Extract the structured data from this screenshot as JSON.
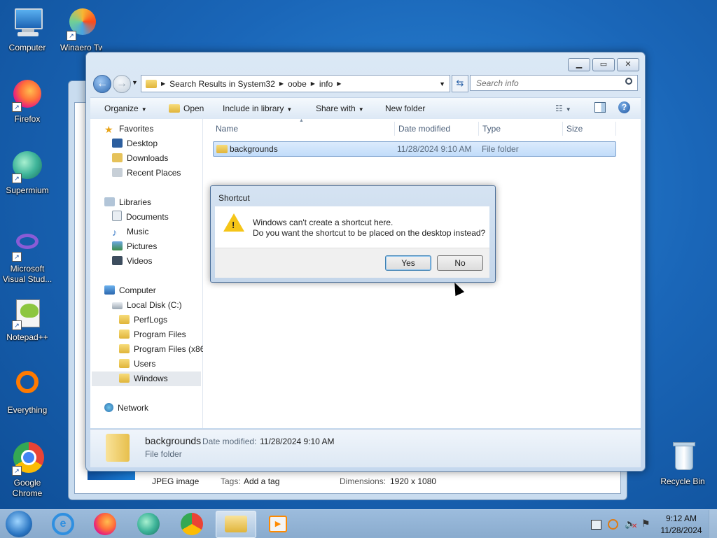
{
  "desktop": {
    "icons": [
      {
        "label": "Computer"
      },
      {
        "label": "Winaero Twea"
      },
      {
        "label": "Firefox"
      },
      {
        "label": "Supermium"
      },
      {
        "label": "Microsoft Visual Stud..."
      },
      {
        "label": "Notepad++"
      },
      {
        "label": "Everything"
      },
      {
        "label": "Google Chrome"
      },
      {
        "label": "Recycle Bin"
      }
    ]
  },
  "back_window": {
    "type_label": "JPEG image",
    "tags_label": "Tags:",
    "tags_value": "Add a tag",
    "dimensions_label": "Dimensions:",
    "dimensions_value": "1920 x 1080"
  },
  "explorer": {
    "address": {
      "segments": [
        "Search Results in System32",
        "oobe",
        "info"
      ]
    },
    "search_placeholder": "Search info",
    "toolbar": {
      "organize": "Organize",
      "open": "Open",
      "include_in_library": "Include in library",
      "share_with": "Share with",
      "new_folder": "New folder"
    },
    "nav": {
      "favorites": "Favorites",
      "desktop": "Desktop",
      "downloads": "Downloads",
      "recent_places": "Recent Places",
      "libraries": "Libraries",
      "documents": "Documents",
      "music": "Music",
      "pictures": "Pictures",
      "videos": "Videos",
      "computer": "Computer",
      "local_disk": "Local Disk (C:)",
      "perflogs": "PerfLogs",
      "program_files": "Program Files",
      "program_files_x86": "Program Files (x86",
      "users": "Users",
      "windows": "Windows",
      "network": "Network"
    },
    "columns": {
      "name": "Name",
      "date_modified": "Date modified",
      "type": "Type",
      "size": "Size"
    },
    "rows": [
      {
        "name": "backgrounds",
        "date": "11/28/2024 9:10 AM",
        "type": "File folder",
        "size": ""
      }
    ],
    "details": {
      "name": "backgrounds",
      "date_label": "Date modified:",
      "date_value": "11/28/2024 9:10 AM",
      "type": "File folder"
    }
  },
  "dialog": {
    "title": "Shortcut",
    "line1": "Windows can't create a shortcut here.",
    "line2": "Do you want the shortcut to be placed on the desktop instead?",
    "yes": "Yes",
    "no": "No"
  },
  "taskbar": {
    "time": "9:12 AM",
    "date": "11/28/2024"
  },
  "colors": {
    "desktop_bg": "#1a66b8",
    "selection": "#c1dcfa",
    "warning": "#f5c518"
  }
}
